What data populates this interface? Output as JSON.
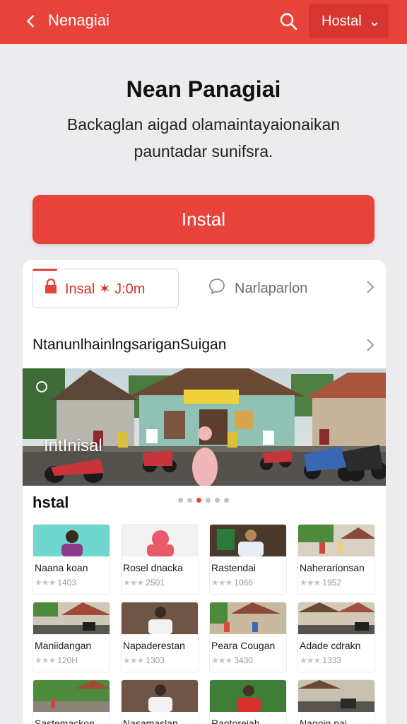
{
  "topbar": {
    "back_icon": "chevron-left-icon",
    "title": "Nenagiai",
    "search_icon": "search-icon",
    "dropdown_value": "Hostal",
    "accent": "#e8433b"
  },
  "hero": {
    "title": "Nean Panagiai",
    "subtitle": "Backaglan aigad olamaintayaionaikan pauntadar sunifsra."
  },
  "install_button": "Instal",
  "card": {
    "join_label": "Insal ✶ J:0m",
    "chat_label": "Narlaparlon",
    "section_title": "NtanunlhainlngsariganSuigan",
    "banner_label": "IntInisal",
    "grid_title": "hstal",
    "carousel": {
      "count": 6,
      "active": 2
    },
    "tiles": [
      {
        "name": "Naana koan",
        "rating": "★★★",
        "count": "1403"
      },
      {
        "name": "Rosel dnacka",
        "rating": "★★★",
        "count": "2501"
      },
      {
        "name": "Rastendai",
        "rating": "★★★",
        "count": "1066"
      },
      {
        "name": "Naherarionsan",
        "rating": "★★★",
        "count": "1952"
      },
      {
        "name": "Maniidangan",
        "rating": "★★★",
        "count": "120H"
      },
      {
        "name": "Napaderestan",
        "rating": "★★★",
        "count": "1303"
      },
      {
        "name": "Peara Cougan",
        "rating": "★★★",
        "count": "3430"
      },
      {
        "name": "Adade cdrakn",
        "rating": "★★★",
        "count": "1333"
      },
      {
        "name": "Sastemackon",
        "rating": "",
        "count": ""
      },
      {
        "name": "Nasamaslan",
        "rating": "",
        "count": ""
      },
      {
        "name": "Rantoreiah",
        "rating": "",
        "count": ""
      },
      {
        "name": "Nagoin pai",
        "rating": "",
        "count": ""
      }
    ]
  }
}
